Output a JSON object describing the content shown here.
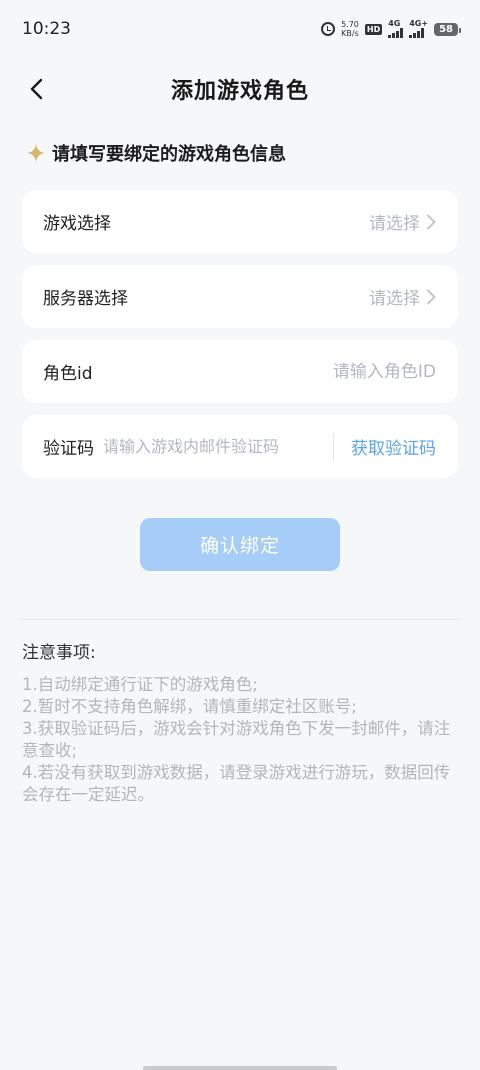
{
  "status_bar": {
    "time": "10:23",
    "net_speed_value": "5.70",
    "net_speed_unit": "KB/s",
    "hd_label": "HD",
    "signal_1_label": "4G",
    "signal_2_label": "4G+",
    "battery": "58"
  },
  "header": {
    "title": "添加游戏角色"
  },
  "hint": {
    "text": "请填写要绑定的游戏角色信息"
  },
  "form": {
    "game_select": {
      "label": "游戏选择",
      "value": "请选择"
    },
    "server_select": {
      "label": "服务器选择",
      "value": "请选择"
    },
    "role_id": {
      "label": "角色id",
      "placeholder": "请输入角色ID"
    },
    "verify_code": {
      "label": "验证码",
      "placeholder": "请输入游戏内邮件验证码",
      "action": "获取验证码"
    }
  },
  "confirm_button": {
    "label": "确认绑定"
  },
  "notes": {
    "title": "注意事项:",
    "items": [
      "1.自动绑定通行证下的游戏角色;",
      "2.暂时不支持角色解绑，请慎重绑定社区账号;",
      "3.获取验证码后，游戏会针对游戏角色下发一封邮件，请注意查收;",
      "4.若没有获取到游戏数据，请登录游戏进行游玩，数据回传会存在一定延迟。"
    ]
  },
  "colors": {
    "accent": "#5aa4e8",
    "confirm_disabled": "#a6cdf7",
    "background": "#f6f7f9",
    "placeholder": "#b4b8bf",
    "spark": "#d8b56a"
  },
  "icons": {
    "back": "chevron-left-icon",
    "hint": "sparkle-icon",
    "select": "chevron-right-icon"
  }
}
